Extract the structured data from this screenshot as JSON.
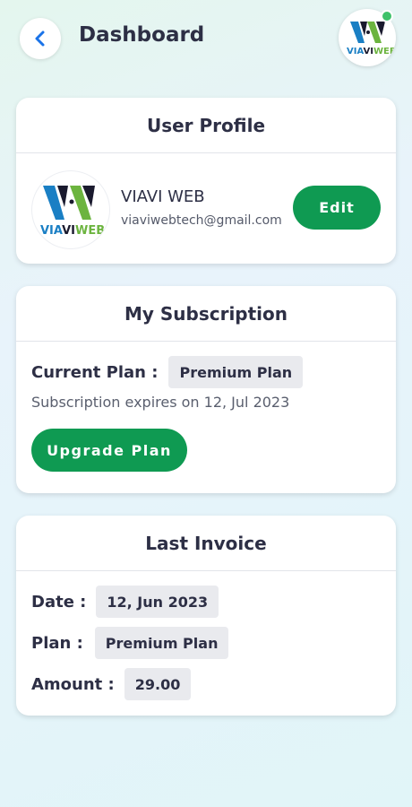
{
  "header": {
    "title": "Dashboard",
    "back_icon": "chevron-left-icon",
    "logo_text_via": "VIA",
    "logo_text_vi": "VI",
    "logo_text_web": "WEB",
    "status_color": "#3ec26a"
  },
  "profile": {
    "title": "User Profile",
    "name": "VIAVI WEB",
    "email": "viaviwebtech@gmail.com",
    "edit_label": "Edit",
    "logo_text_via": "VIA",
    "logo_text_vi": "VI",
    "logo_text_web": "WEB"
  },
  "subscription": {
    "title": "My Subscription",
    "current_plan_label": "Current Plan :",
    "current_plan_value": "Premium Plan",
    "expiry_text": "Subscription expires on 12, Jul 2023",
    "upgrade_label": "Upgrade Plan"
  },
  "invoice": {
    "title": "Last Invoice",
    "date_label": "Date :",
    "date_value": "12, Jun 2023",
    "plan_label": "Plan :",
    "plan_value": "Premium Plan",
    "amount_label": "Amount :",
    "amount_value": "29.00"
  },
  "colors": {
    "accent_green": "#0f9a52",
    "back_icon_blue": "#1a73e8",
    "logo_blue": "#1a7fc4",
    "logo_green": "#6cb43f"
  }
}
